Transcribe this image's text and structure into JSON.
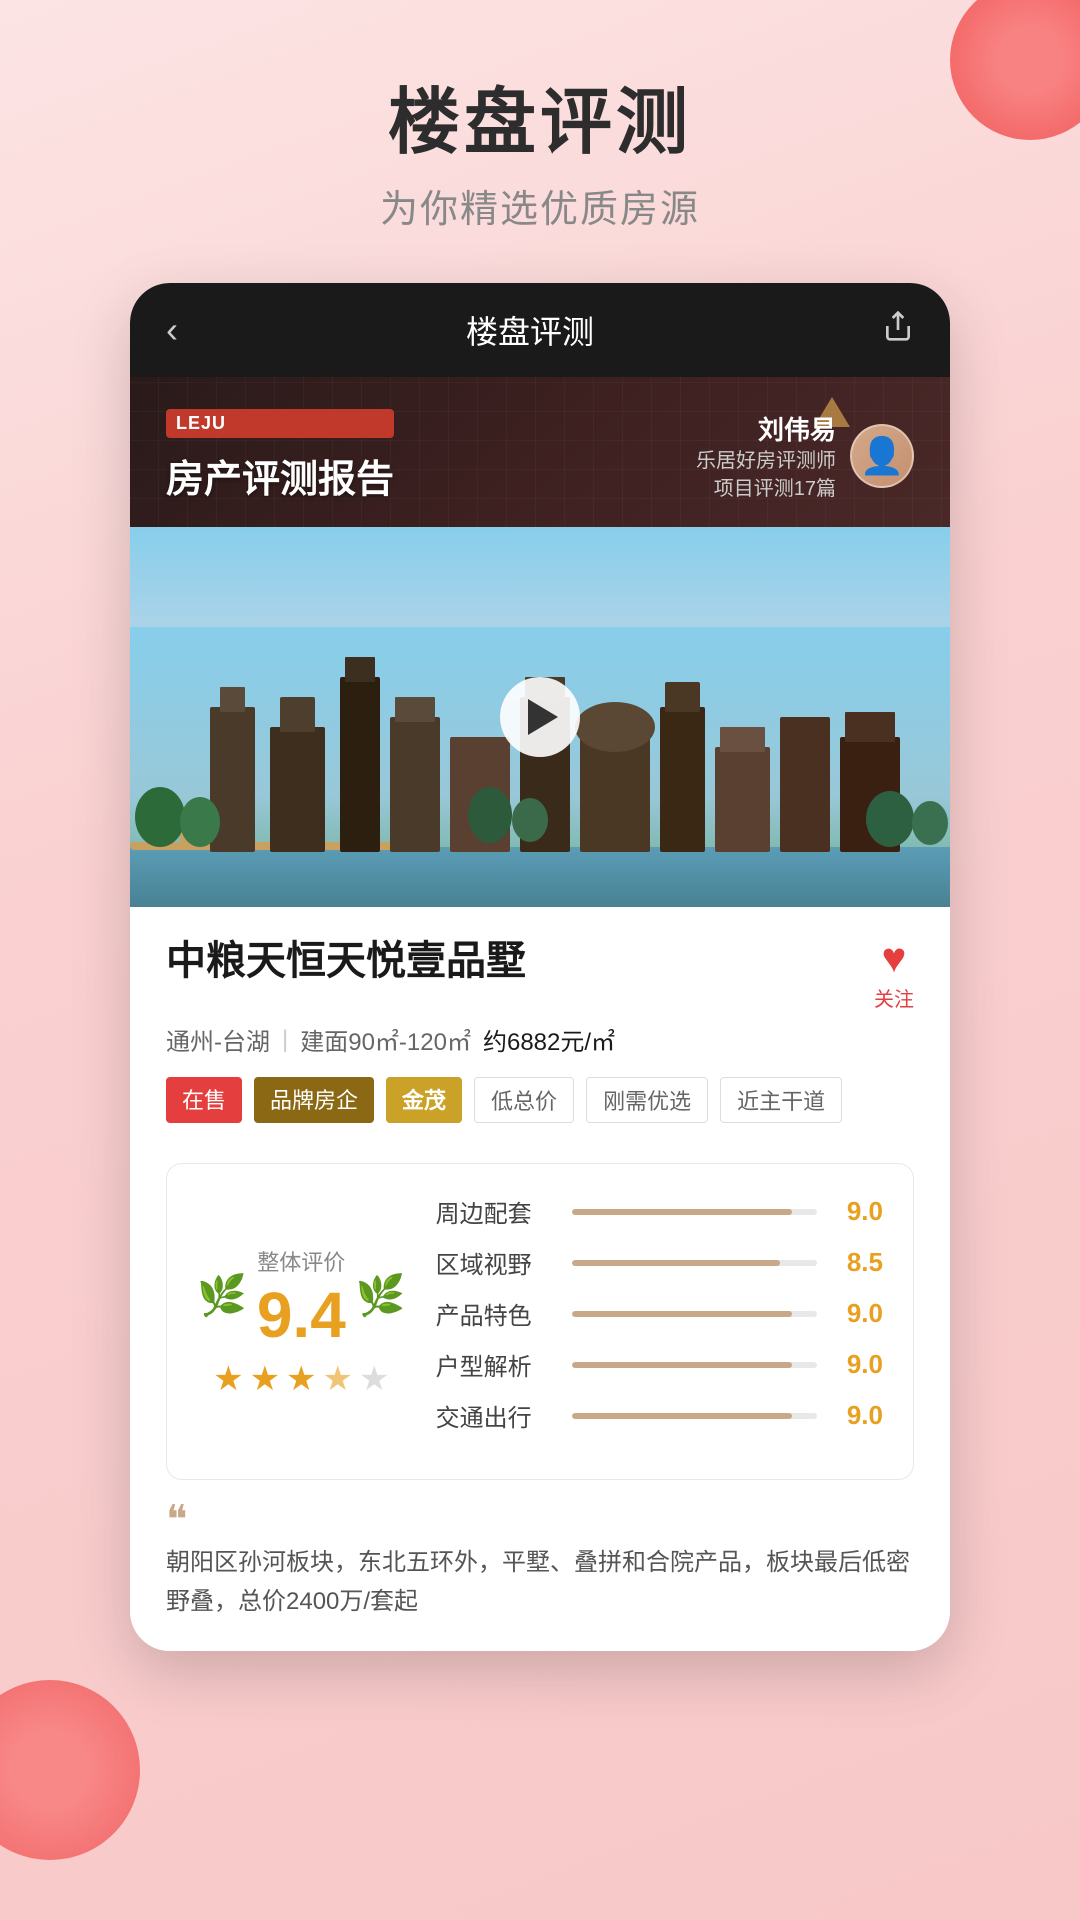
{
  "header": {
    "main_title": "楼盘评测",
    "sub_title": "为你精选优质房源"
  },
  "nav": {
    "back_label": "‹",
    "title": "楼盘评测",
    "share_icon": "share"
  },
  "report": {
    "logo_text": "LEJU",
    "report_title": "房产评测报告",
    "reviewer_name": "刘伟易",
    "reviewer_role_line1": "乐居好房评测师",
    "reviewer_role_line2": "项目评测17篇"
  },
  "property": {
    "name": "中粮天恒天悦壹品墅",
    "location": "通州-台湖",
    "area": "建面90㎡-120㎡",
    "price": "约6882元/㎡",
    "follow_label": "关注",
    "tags": [
      {
        "text": "在售",
        "style": "sale"
      },
      {
        "text": "品牌房企",
        "style": "brand"
      },
      {
        "text": "金茂",
        "style": "brand-name"
      },
      {
        "text": "低总价",
        "style": "outline"
      },
      {
        "text": "刚需优选",
        "style": "outline"
      },
      {
        "text": "近主干道",
        "style": "outline"
      }
    ]
  },
  "rating": {
    "overall_label": "整体评价",
    "overall_score": "9.4",
    "stars": [
      "full",
      "full",
      "full",
      "half",
      "empty"
    ],
    "items": [
      {
        "label": "周边配套",
        "value": "9.0",
        "percent": 90
      },
      {
        "label": "区域视野",
        "value": "8.5",
        "percent": 85
      },
      {
        "label": "产品特色",
        "value": "9.0",
        "percent": 90
      },
      {
        "label": "户型解析",
        "value": "9.0",
        "percent": 90
      },
      {
        "label": "交通出行",
        "value": "9.0",
        "percent": 90
      }
    ]
  },
  "description": {
    "quote": "““",
    "text": "朝阳区孙河板块，东北五环外，平墅、叠拼和合院产品，板块最后低密野叠，总价2400万/套起"
  }
}
